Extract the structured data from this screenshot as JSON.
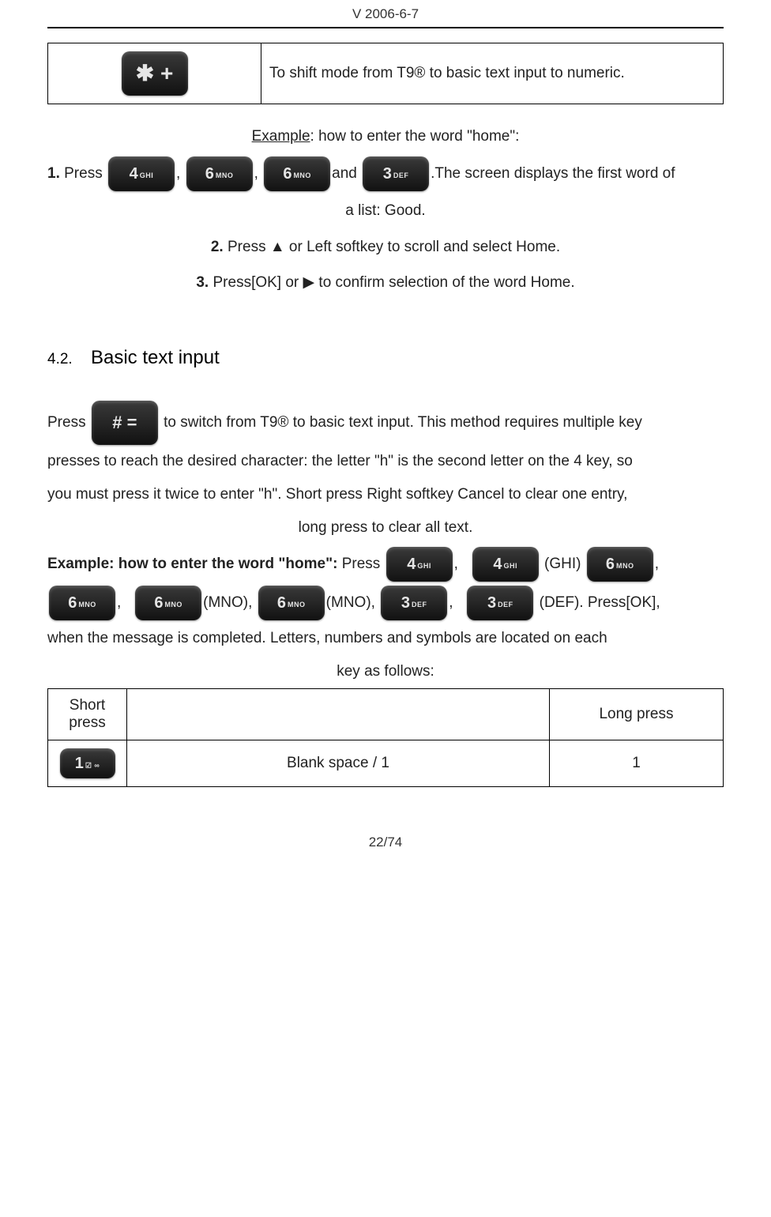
{
  "header": {
    "version": "V 2006-6-7"
  },
  "star_row": {
    "key_glyph": "✱ +",
    "desc": "To shift mode from T9® to basic text input to numeric."
  },
  "example1": {
    "label": "Example",
    "after_label": ": how to enter the word \"home\":",
    "step1_num": "1.",
    "step1_a": " Press",
    "step1_b": ",",
    "step1_c": ",",
    "step1_d": "and ",
    "step1_e": ".The screen displays the first word of",
    "step1_line2": "a list: Good.",
    "key4": "4",
    "key4_sub": "GHI",
    "key6": "6",
    "key6_sub": "MNO",
    "key3": "3",
    "key3_sub": "DEF",
    "step2_num": "2.",
    "step2_text": " Press ▲ or Left softkey to scroll and select Home.",
    "step3_num": "3.",
    "step3_text": "  Press[OK] or ▶ to confirm selection of the word Home."
  },
  "section42": {
    "num": "4.2.",
    "title": "Basic text input"
  },
  "para42": {
    "press_label": "Press",
    "hash_glyph": "# =",
    "rest_a": "to switch from T9® to basic text input. This method requires multiple key",
    "line2": "presses to reach the desired character: the letter \"h\" is the second letter on the 4 key, so",
    "line3": "you must press it twice to enter \"h\". Short press Right softkey Cancel to clear one entry,",
    "line4": "long press to clear all text."
  },
  "example2": {
    "label": "Example: how to enter the word \"home\":",
    "press": " Press",
    "ghi_label": " (GHI) ",
    "mno_label": "(MNO),  ",
    "mno_label2": "(MNO),  ",
    "def_label": " (DEF). Press[OK],",
    "tail1": " when the message is completed. Letters, numbers and symbols are located on each",
    "tail2": "key as follows:",
    "key4": "4",
    "key4_sub": "GHI",
    "key6": "6",
    "key6_sub": "MNO",
    "key3": "3",
    "key3_sub": "DEF"
  },
  "table2": {
    "short_press": "Short press",
    "long_press": "Long press",
    "row1_key": "1",
    "row1_key_sub": "☑ ∞",
    "row1_mid": "Blank space / 1",
    "row1_long": "1"
  },
  "footer": {
    "page": "22/74"
  }
}
